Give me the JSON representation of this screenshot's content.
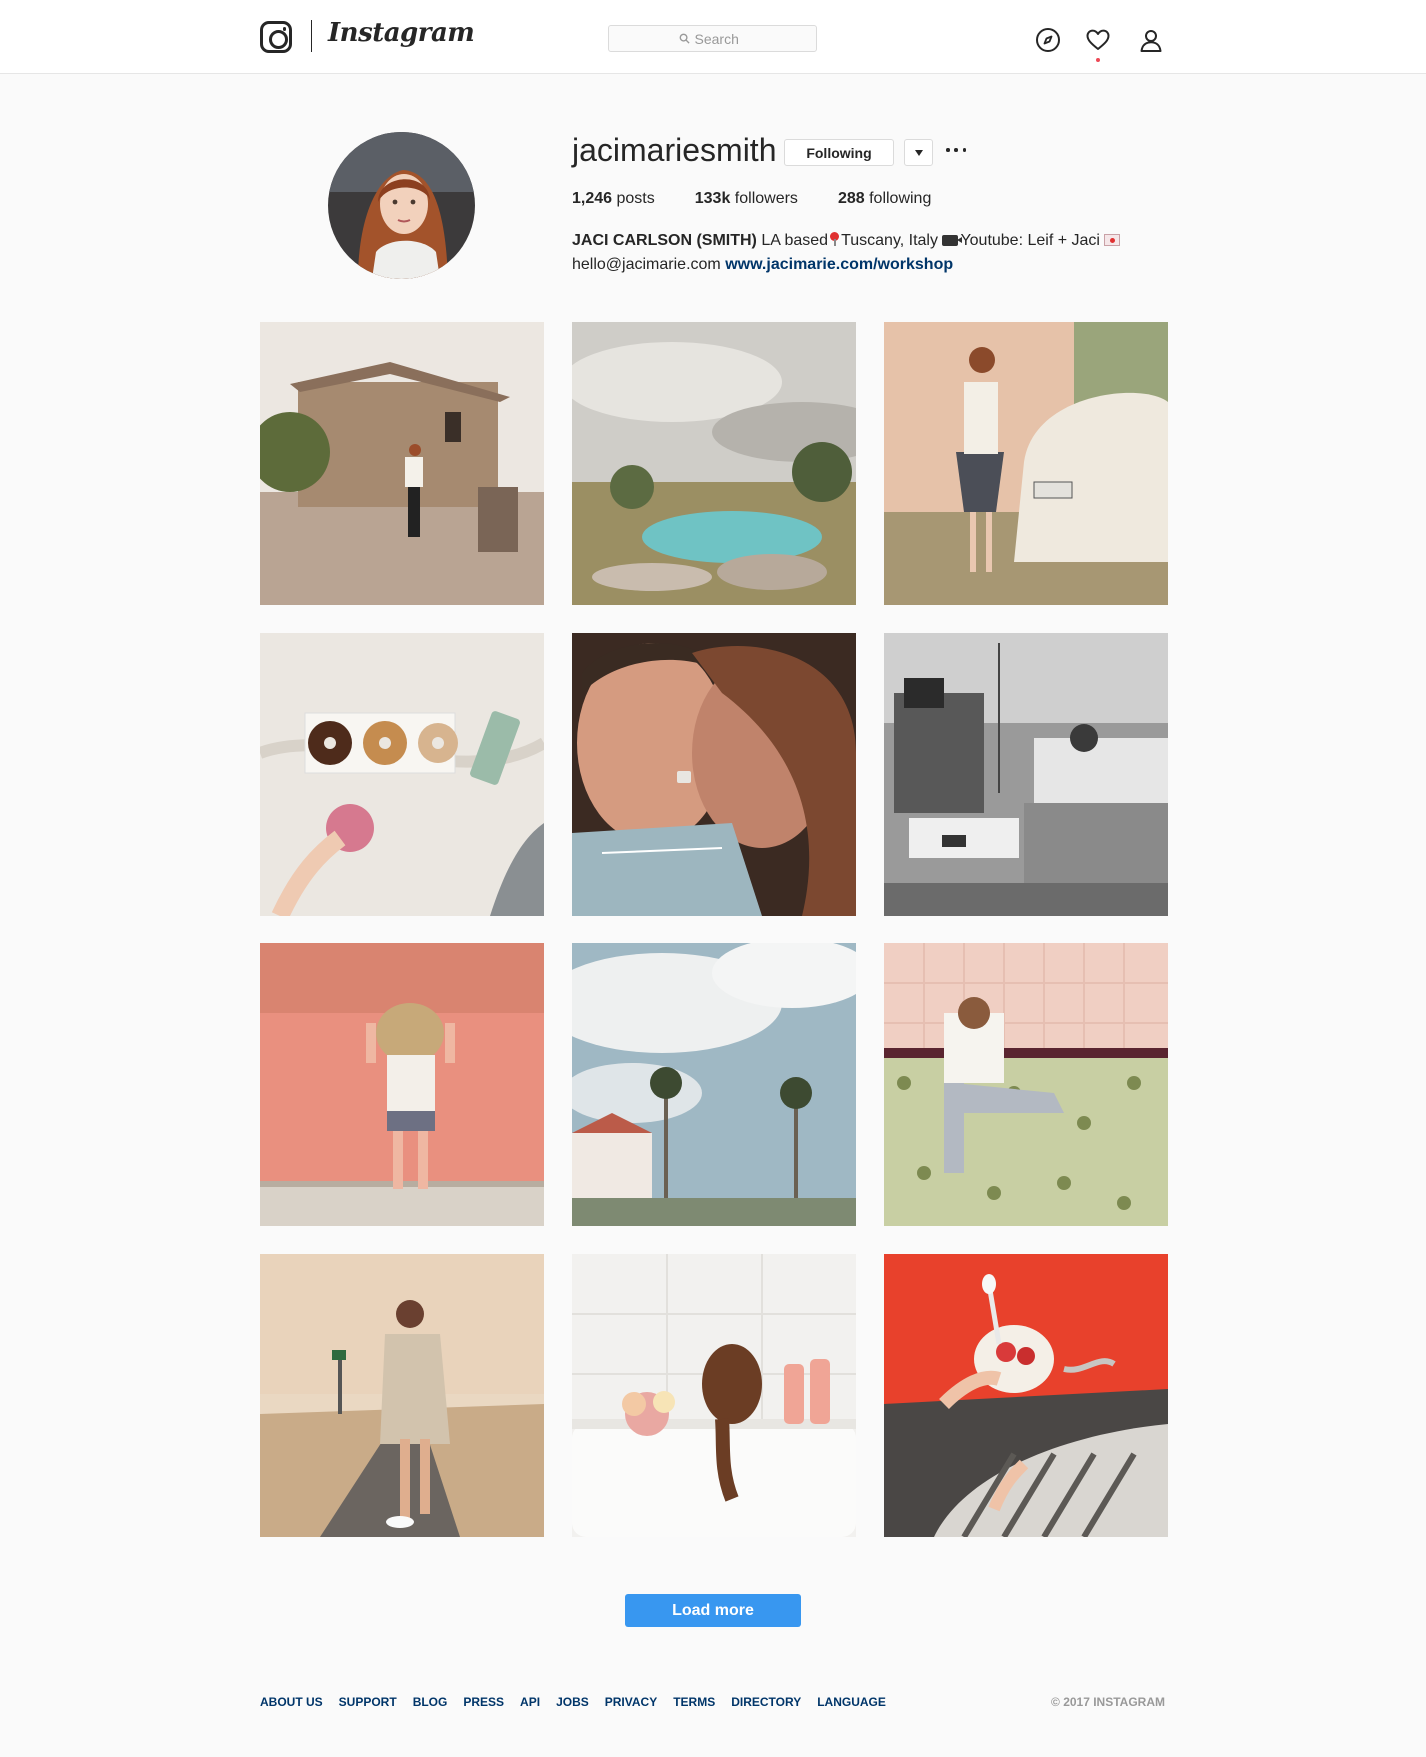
{
  "header": {
    "wordmark": "Instagram",
    "search": {
      "placeholder": "Search",
      "value": ""
    },
    "icons": [
      "compass-icon",
      "heart-icon",
      "profile-icon"
    ],
    "notification_dot": true
  },
  "profile": {
    "username": "jacimariesmith",
    "follow_button": "Following",
    "stats": {
      "posts_count": "1,246",
      "posts_label": "posts",
      "followers_count": "133k",
      "followers_label": "followers",
      "following_count": "288",
      "following_label": "following"
    },
    "bio": {
      "name": "JACI CARLSON (SMITH)",
      "text1": " LA based",
      "text2": "Tuscany, Italy ",
      "text3": "Youtube: Leif + Jaci",
      "email": "hello@jacimarie.com ",
      "link": "www.jacimarie.com/workshop"
    }
  },
  "load_more": "Load more",
  "footer": {
    "links": [
      "ABOUT US",
      "SUPPORT",
      "BLOG",
      "PRESS",
      "API",
      "JOBS",
      "PRIVACY",
      "TERMS",
      "DIRECTORY",
      "LANGUAGE"
    ],
    "copyright": "© 2017 INSTAGRAM"
  },
  "colors": {
    "accent_blue": "#3897f0",
    "link_navy": "#003569",
    "notification_red": "#ed4956"
  }
}
